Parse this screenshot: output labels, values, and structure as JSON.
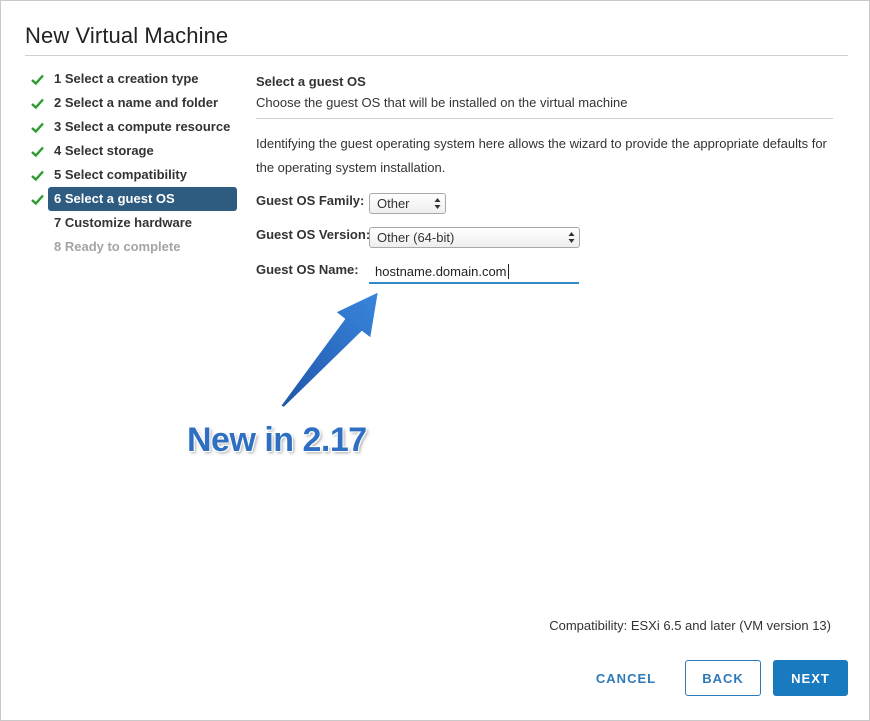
{
  "dialog": {
    "title": "New Virtual Machine"
  },
  "steps": [
    {
      "label": "1 Select a creation type",
      "state": "done"
    },
    {
      "label": "2 Select a name and folder",
      "state": "done"
    },
    {
      "label": "3 Select a compute resource",
      "state": "done"
    },
    {
      "label": "4 Select storage",
      "state": "done"
    },
    {
      "label": "5 Select compatibility",
      "state": "done"
    },
    {
      "label": "6 Select a guest OS",
      "state": "active"
    },
    {
      "label": "7 Customize hardware",
      "state": "pending"
    },
    {
      "label": "8 Ready to complete",
      "state": "disabled"
    }
  ],
  "content": {
    "title": "Select a guest OS",
    "subtitle": "Choose the guest OS that will be installed on the virtual machine",
    "description": "Identifying the guest operating system here allows the wizard to provide the appropriate defaults for the operating system installation.",
    "fields": {
      "family": {
        "label": "Guest OS Family:",
        "value": "Other"
      },
      "version": {
        "label": "Guest OS Version:",
        "value": "Other (64-bit)"
      },
      "name": {
        "label": "Guest OS Name:",
        "value": "hostname.domain.com"
      }
    }
  },
  "annotation": {
    "text": "New in 2.17"
  },
  "footer": {
    "compatibility": "Compatibility: ESXi 6.5 and later (VM version 13)",
    "cancel_label": "CANCEL",
    "back_label": "BACK",
    "next_label": "NEXT"
  },
  "colors": {
    "check": "#2f9a2f",
    "active_step_bg": "#2e5b80",
    "accent": "#1a7ac0",
    "annotation": "#2f6fc2"
  },
  "icons": [
    "check-icon",
    "select-arrows-icon",
    "annotation-arrow-icon"
  ]
}
